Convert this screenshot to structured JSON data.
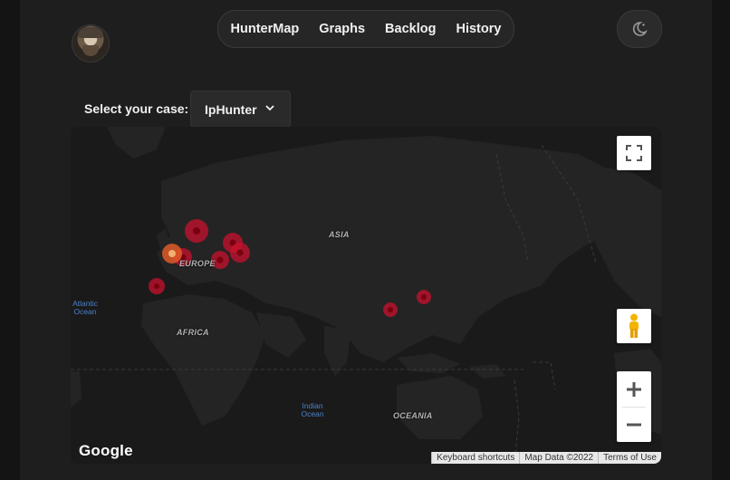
{
  "nav": {
    "items": [
      {
        "label": "HunterMap"
      },
      {
        "label": "Graphs"
      },
      {
        "label": "Backlog"
      },
      {
        "label": "History"
      }
    ]
  },
  "theme_toggle": {
    "icon": "moon-stars-icon"
  },
  "case_select": {
    "label": "Select your case:",
    "value": "IpHunter"
  },
  "map": {
    "region_labels": {
      "asia": "ASIA",
      "europe": "EUROPE",
      "africa": "AFRICA",
      "oceania": "OCEANIA"
    },
    "ocean_labels": {
      "atlantic": "Atlantic\nOcean",
      "indian": "Indian\nOcean"
    },
    "logo": "Google",
    "attribution": {
      "shortcuts": "Keyboard shortcuts",
      "data": "Map Data ©2022",
      "terms": "Terms of Use"
    },
    "controls": {
      "fullscreen_icon": "fullscreen-icon",
      "pegman_icon": "pegman-icon",
      "zoom_in_icon": "plus-icon",
      "zoom_out_icon": "minus-icon"
    },
    "marker_color": "#c8102e",
    "marker_count": 10
  }
}
